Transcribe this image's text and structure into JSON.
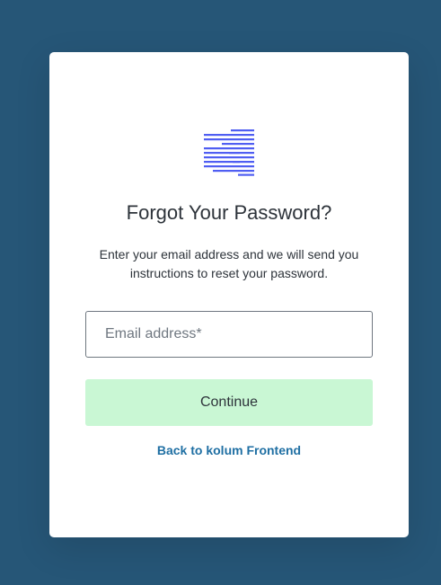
{
  "logo": {
    "icon": "stacked-lines-logo-icon",
    "color": "#4f5ef2"
  },
  "heading": "Forgot Your Password?",
  "description": "Enter your email address and we will send you instructions to reset your password.",
  "email_field": {
    "placeholder": "Email address*",
    "value": ""
  },
  "continue_button": {
    "label": "Continue",
    "color": "#c9f7d4"
  },
  "back_link": {
    "label": "Back to kolum Frontend",
    "color": "#1f6fa3"
  },
  "colors": {
    "background": "#265677",
    "card": "#ffffff",
    "text": "#2d333a"
  }
}
